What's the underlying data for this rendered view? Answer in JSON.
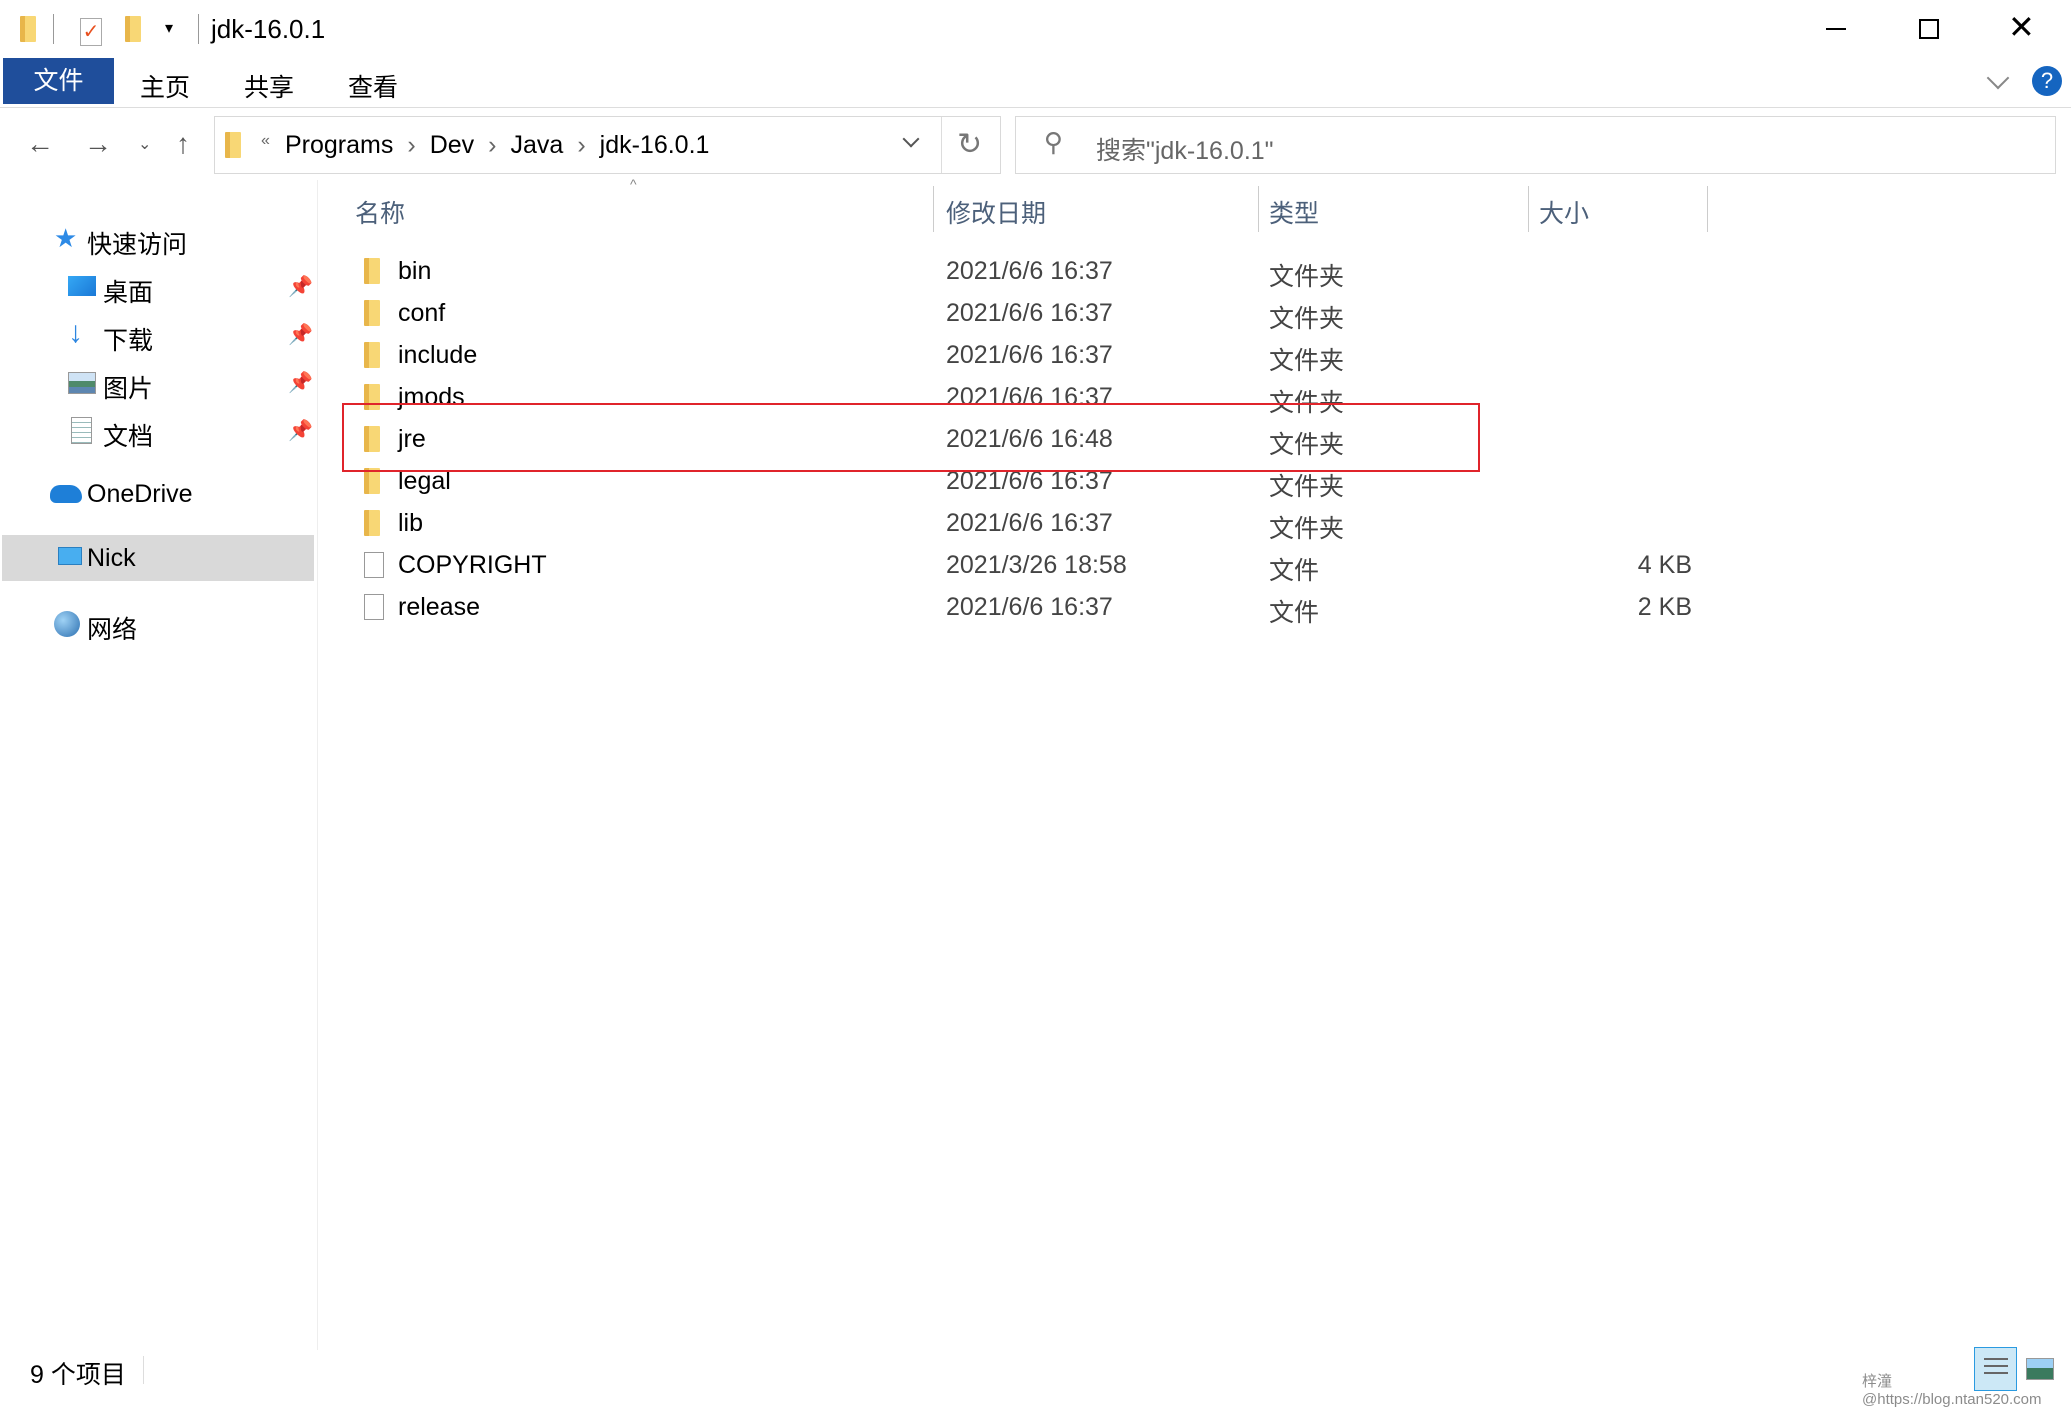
{
  "window": {
    "title": "jdk-16.0.1",
    "minimize_icon": "minimize-icon",
    "maximize_icon": "maximize-icon",
    "close_icon": "close-icon"
  },
  "ribbon": {
    "tabs": [
      {
        "label": "文件",
        "active": true
      },
      {
        "label": "主页"
      },
      {
        "label": "共享"
      },
      {
        "label": "查看"
      }
    ],
    "accent": "#1f4e9b"
  },
  "address": {
    "overflow": "«",
    "crumbs": [
      "Programs",
      "Dev",
      "Java",
      "jdk-16.0.1"
    ]
  },
  "search": {
    "placeholder": "搜索\"jdk-16.0.1\""
  },
  "sidebar": {
    "quick_access": "快速访问",
    "items": [
      {
        "label": "桌面",
        "pinned": true
      },
      {
        "label": "下载",
        "pinned": true
      },
      {
        "label": "图片",
        "pinned": true
      },
      {
        "label": "文档",
        "pinned": true
      }
    ],
    "onedrive": "OneDrive",
    "pc": "Nick",
    "network": "网络"
  },
  "columns": {
    "name": "名称",
    "date": "修改日期",
    "type": "类型",
    "size": "大小"
  },
  "files": [
    {
      "name": "bin",
      "date": "2021/6/6 16:37",
      "type": "文件夹",
      "size": "",
      "kind": "folder"
    },
    {
      "name": "conf",
      "date": "2021/6/6 16:37",
      "type": "文件夹",
      "size": "",
      "kind": "folder"
    },
    {
      "name": "include",
      "date": "2021/6/6 16:37",
      "type": "文件夹",
      "size": "",
      "kind": "folder"
    },
    {
      "name": "jmods",
      "date": "2021/6/6 16:37",
      "type": "文件夹",
      "size": "",
      "kind": "folder"
    },
    {
      "name": "jre",
      "date": "2021/6/6 16:48",
      "type": "文件夹",
      "size": "",
      "kind": "folder",
      "highlighted": true
    },
    {
      "name": "legal",
      "date": "2021/6/6 16:37",
      "type": "文件夹",
      "size": "",
      "kind": "folder"
    },
    {
      "name": "lib",
      "date": "2021/6/6 16:37",
      "type": "文件夹",
      "size": "",
      "kind": "folder"
    },
    {
      "name": "COPYRIGHT",
      "date": "2021/3/26 18:58",
      "type": "文件",
      "size": "4 KB",
      "kind": "file"
    },
    {
      "name": "release",
      "date": "2021/6/6 16:37",
      "type": "文件",
      "size": "2 KB",
      "kind": "file"
    }
  ],
  "status": {
    "count": "9 个项目"
  },
  "watermark": "梓潼@https://blog.ntan520.com",
  "highlight_color": "#e0242b"
}
